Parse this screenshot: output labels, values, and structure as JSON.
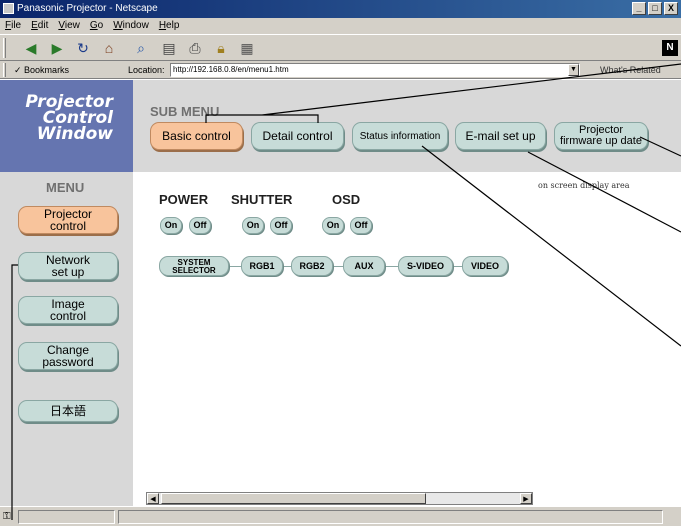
{
  "window": {
    "title": "Panasonic Projector - Netscape",
    "buttons": [
      "_",
      "□",
      "X"
    ]
  },
  "menubar": [
    "File",
    "Edit",
    "View",
    "Go",
    "Window",
    "Help"
  ],
  "toolbar": {
    "icons": [
      "back-icon",
      "forward-icon",
      "reload-icon",
      "home-icon",
      "search-icon",
      "my-netscape-icon",
      "print-icon",
      "security-icon",
      "stop-icon"
    ],
    "logo": "N"
  },
  "location": {
    "bookmarks_label": "Bookmarks",
    "label": "Location:",
    "url": "http://192.168.0.8/en/menu1.htm",
    "related_label": "What's Related"
  },
  "logo": {
    "text": "Projector\nControl\nWindow"
  },
  "submenu": {
    "title": "SUB MENU",
    "tabs": [
      "Basic control",
      "Detail control",
      "Status information",
      "E-mail set up",
      "Projector\nfirmware up date"
    ]
  },
  "sidebar": {
    "title": "MENU",
    "items": [
      "Projector\ncontrol",
      "Network\nset up",
      "Image\ncontrol",
      "Change\npassword",
      "日本語"
    ]
  },
  "controls": {
    "power": {
      "label": "POWER",
      "on": "On",
      "off": "Off"
    },
    "shutter": {
      "label": "SHUTTER",
      "on": "On",
      "off": "Off"
    },
    "osd": {
      "label": "OSD",
      "on": "On",
      "off": "Off"
    },
    "osd_note": "on screen display area"
  },
  "inputs": [
    "SYSTEM\nSELECTOR",
    "RGB1",
    "RGB2",
    "AUX",
    "S-VIDEO",
    "VIDEO"
  ],
  "colors": {
    "active": "#f8c49c",
    "button": "#c7dcd8",
    "logo_bg": "#6575b0",
    "band": "#d8d8d8"
  }
}
